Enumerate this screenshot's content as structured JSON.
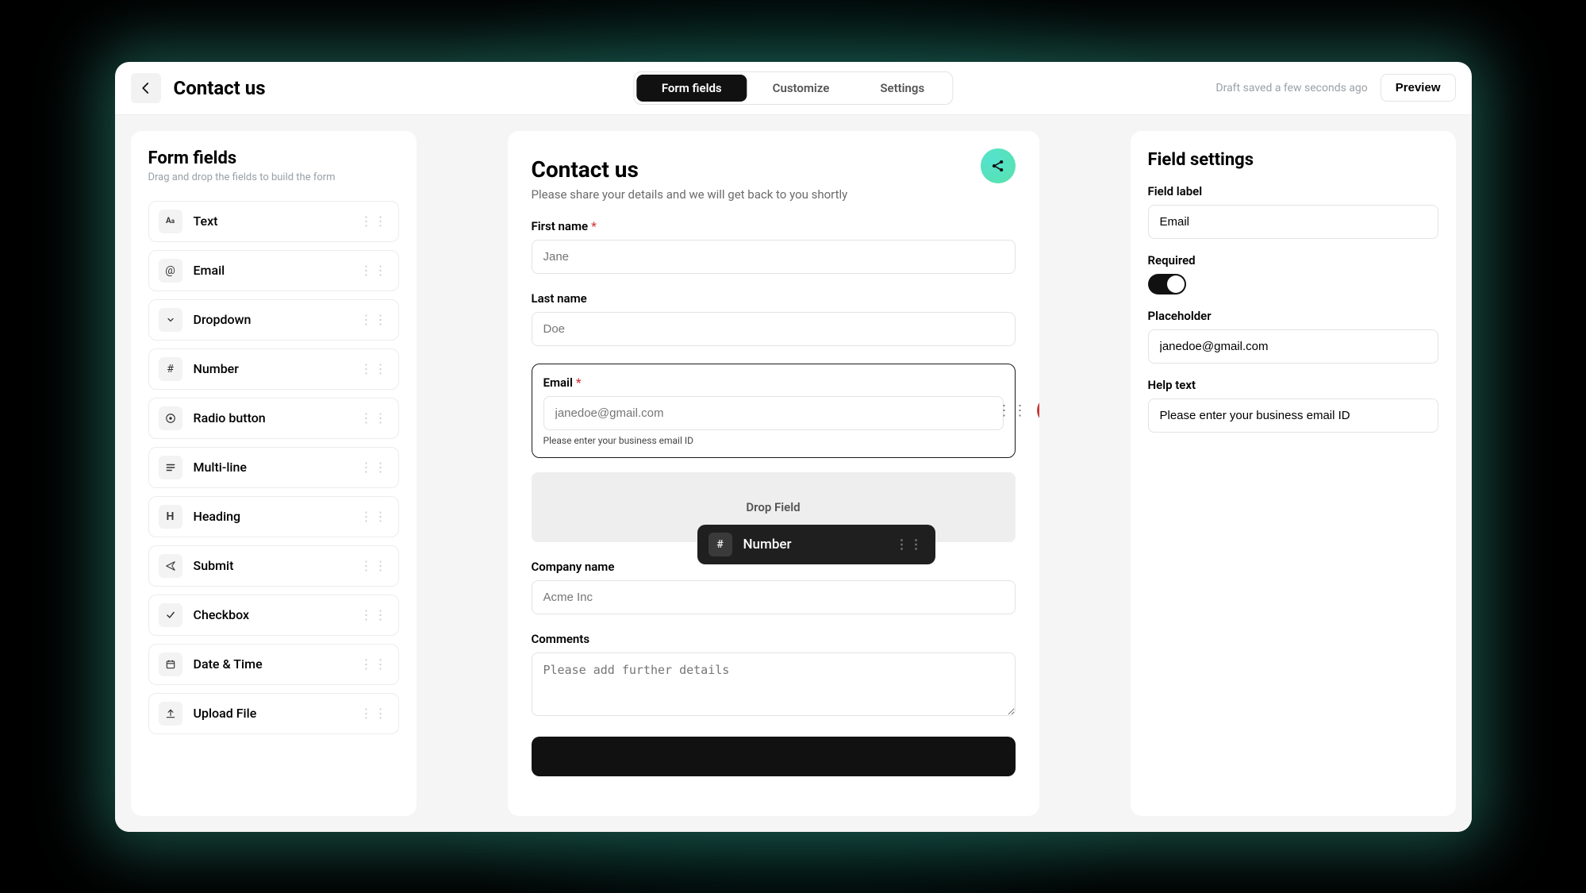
{
  "page_title": "Contact us",
  "tabs": {
    "form_fields": "Form fields",
    "customize": "Customize",
    "settings": "Settings"
  },
  "draft_status": "Draft saved a few seconds ago",
  "preview_label": "Preview",
  "sidebar": {
    "title": "Form fields",
    "subtitle": "Drag and drop the fields to build the form",
    "items": [
      {
        "label": "Text",
        "icon": "Aa"
      },
      {
        "label": "Email",
        "icon": "@"
      },
      {
        "label": "Dropdown",
        "icon": "chevron"
      },
      {
        "label": "Number",
        "icon": "#"
      },
      {
        "label": "Radio button",
        "icon": "radio"
      },
      {
        "label": "Multi-line",
        "icon": "lines"
      },
      {
        "label": "Heading",
        "icon": "H"
      },
      {
        "label": "Submit",
        "icon": "send"
      },
      {
        "label": "Checkbox",
        "icon": "check"
      },
      {
        "label": "Date & Time",
        "icon": "calendar"
      },
      {
        "label": "Upload File",
        "icon": "upload"
      }
    ]
  },
  "canvas": {
    "title": "Contact us",
    "description": "Please share your details and we will get back to you shortly",
    "drop_label": "Drop Field",
    "dragging_field_label": "Number",
    "fields": {
      "first_name": {
        "label": "First name",
        "placeholder": "Jane",
        "required": true
      },
      "last_name": {
        "label": "Last name",
        "placeholder": "Doe",
        "required": false
      },
      "email": {
        "label": "Email",
        "placeholder": "janedoe@gmail.com",
        "required": true,
        "help_text": "Please enter your business email ID"
      },
      "company": {
        "label": "Company name",
        "placeholder": "Acme Inc",
        "required": false
      },
      "comments": {
        "label": "Comments",
        "placeholder": "Please add further details",
        "required": false
      }
    }
  },
  "settings_panel": {
    "title": "Field settings",
    "labels": {
      "field_label": "Field label",
      "required": "Required",
      "placeholder": "Placeholder",
      "help_text": "Help text"
    },
    "values": {
      "field_label": "Email",
      "required_on": true,
      "placeholder": "janedoe@gmail.com",
      "help_text": "Please enter your business email ID"
    }
  }
}
